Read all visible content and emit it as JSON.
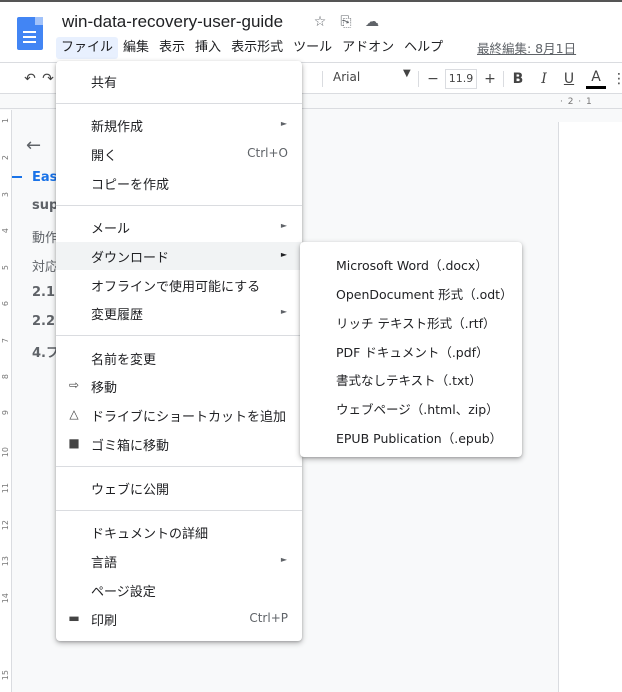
{
  "header": {
    "doc_title": "win-data-recovery-user-guide",
    "last_edit": "最終編集: 8月1日"
  },
  "menubar": {
    "items": [
      "ファイル",
      "編集",
      "表示",
      "挿入",
      "表示形式",
      "ツール",
      "アドオン",
      "ヘルプ"
    ]
  },
  "toolbar": {
    "font": "Arial",
    "font_size": "11.9",
    "minus": "−",
    "plus": "+",
    "bold": "B",
    "italic": "I",
    "underline": "U",
    "text_color": "A"
  },
  "ruler": {
    "marks": "· 2 · 1",
    "vertical": [
      "1",
      "2",
      "3",
      "4",
      "5",
      "6",
      "7",
      "8",
      "9",
      "10",
      "11",
      "12",
      "13",
      "14",
      "15"
    ]
  },
  "outline": {
    "items": [
      "Eas",
      "sup",
      "動作",
      "対応",
      "2.1",
      "2.2",
      "4.フ"
    ]
  },
  "file_menu": {
    "share": "共有",
    "new": "新規作成",
    "open": "開く",
    "open_shortcut": "Ctrl+O",
    "make_copy": "コピーを作成",
    "email": "メール",
    "download": "ダウンロード",
    "offline": "オフラインで使用可能にする",
    "version_history": "変更履歴",
    "rename": "名前を変更",
    "move": "移動",
    "add_shortcut": "ドライブにショートカットを追加",
    "trash": "ゴミ箱に移動",
    "publish": "ウェブに公開",
    "details": "ドキュメントの詳細",
    "language": "言語",
    "page_setup": "ページ設定",
    "print": "印刷",
    "print_shortcut": "Ctrl+P"
  },
  "download_submenu": {
    "items": [
      "Microsoft Word（.docx）",
      "OpenDocument 形式（.odt）",
      "リッチ テキスト形式（.rtf）",
      "PDF ドキュメント（.pdf）",
      "書式なしテキスト（.txt）",
      "ウェブページ（.html、zip）",
      "EPUB Publication（.epub）"
    ]
  },
  "colors": {
    "accent": "#1a73e8",
    "doc_icon": "#4285f4",
    "highlight": "#f1f3f4"
  }
}
